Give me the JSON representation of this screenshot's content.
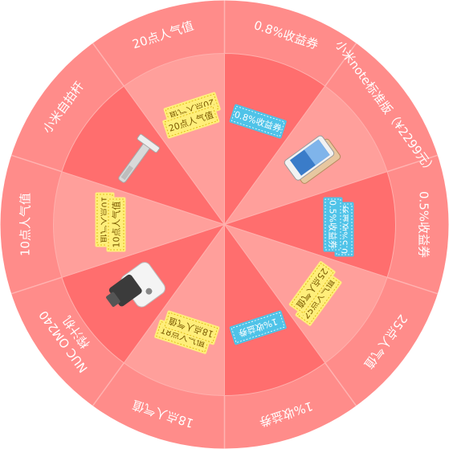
{
  "wheel": {
    "colors": {
      "outer_ring": "#ff8c8a",
      "outer_divider": "#ffb3b1",
      "inner_dark": "#ff6e6e",
      "inner_light": "#ff9f9b",
      "inner_divider": "#ffb0ad",
      "yellow_ticket": "#ffee7a",
      "blue_ticket": "#4fc3e8",
      "text_white": "#ffffff"
    },
    "segments": [
      {
        "label": "0.8%收益券",
        "prize": {
          "kind": "coupon",
          "style": "blue",
          "text": "0.8%收益券"
        }
      },
      {
        "label": "小米note标准版（¥2299元）",
        "prize": {
          "kind": "phone-icon"
        }
      },
      {
        "label": "0.5%收益券",
        "prize": {
          "kind": "coupon",
          "style": "blue",
          "text": "0.5%收益券",
          "back_text": "0.5%收益券"
        }
      },
      {
        "label": "25点人气值",
        "prize": {
          "kind": "coupon",
          "style": "yellow",
          "text": "25点人气值",
          "back_text": "25点人气值"
        }
      },
      {
        "label": "1%收益券",
        "prize": {
          "kind": "coupon",
          "style": "blue",
          "text": "1%收益券"
        }
      },
      {
        "label": "18点人气值",
        "prize": {
          "kind": "coupon",
          "style": "yellow",
          "text": "18点人气值",
          "back_text": "18点人气值"
        }
      },
      {
        "label": "NUC OM240 榨汁机",
        "label_lines": [
          "NUC OM240",
          "榨汁机"
        ],
        "prize": {
          "kind": "juicer-icon"
        }
      },
      {
        "label": "10点人气值",
        "prize": {
          "kind": "coupon",
          "style": "yellow",
          "text": "10点人气值",
          "back_text": "10点人气值"
        }
      },
      {
        "label": "小米自拍杆",
        "prize": {
          "kind": "selfie-stick-icon"
        }
      },
      {
        "label": "20点人气值",
        "prize": {
          "kind": "coupon",
          "style": "yellow",
          "text": "20点人气值",
          "back_text": "20点人气值"
        }
      }
    ]
  }
}
